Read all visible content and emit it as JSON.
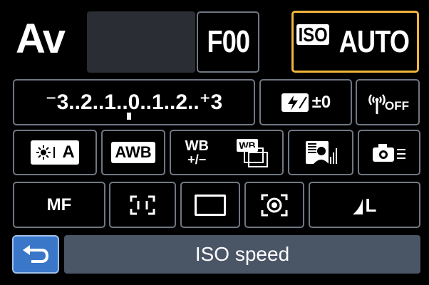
{
  "header": {
    "mode": "Av",
    "aperture": "F00",
    "iso_label": "ISO",
    "iso_value": "AUTO"
  },
  "exposure": {
    "scale": "⁻3..2..1..0..1..2..⁺3"
  },
  "flash_comp": {
    "value": "±0"
  },
  "wireless": {
    "off_label": "OFF"
  },
  "row3": {
    "picture_style": "A",
    "white_balance": "AWB",
    "wb_shift_top": "WB",
    "wb_shift_bottom": "+/−",
    "wb_bracket": "WB"
  },
  "row4": {
    "focus_mode": "MF",
    "image_quality": "L"
  },
  "footer": {
    "label": "ISO speed"
  },
  "colors": {
    "selection": "#f0b43a",
    "tile_border": "#6f7782",
    "back_button": "#3a77c9",
    "label_bar": "#4a5566"
  },
  "icons": [
    "flash-exposure-comp-icon",
    "wireless-off-icon",
    "picture-style-icon",
    "wb-bracket-icon",
    "auto-lighting-optimizer-icon",
    "custom-controls-icon",
    "af-frame-icon",
    "metering-rectangle-icon",
    "evaluative-metering-icon",
    "image-quality-icon",
    "back-arrow-icon"
  ]
}
